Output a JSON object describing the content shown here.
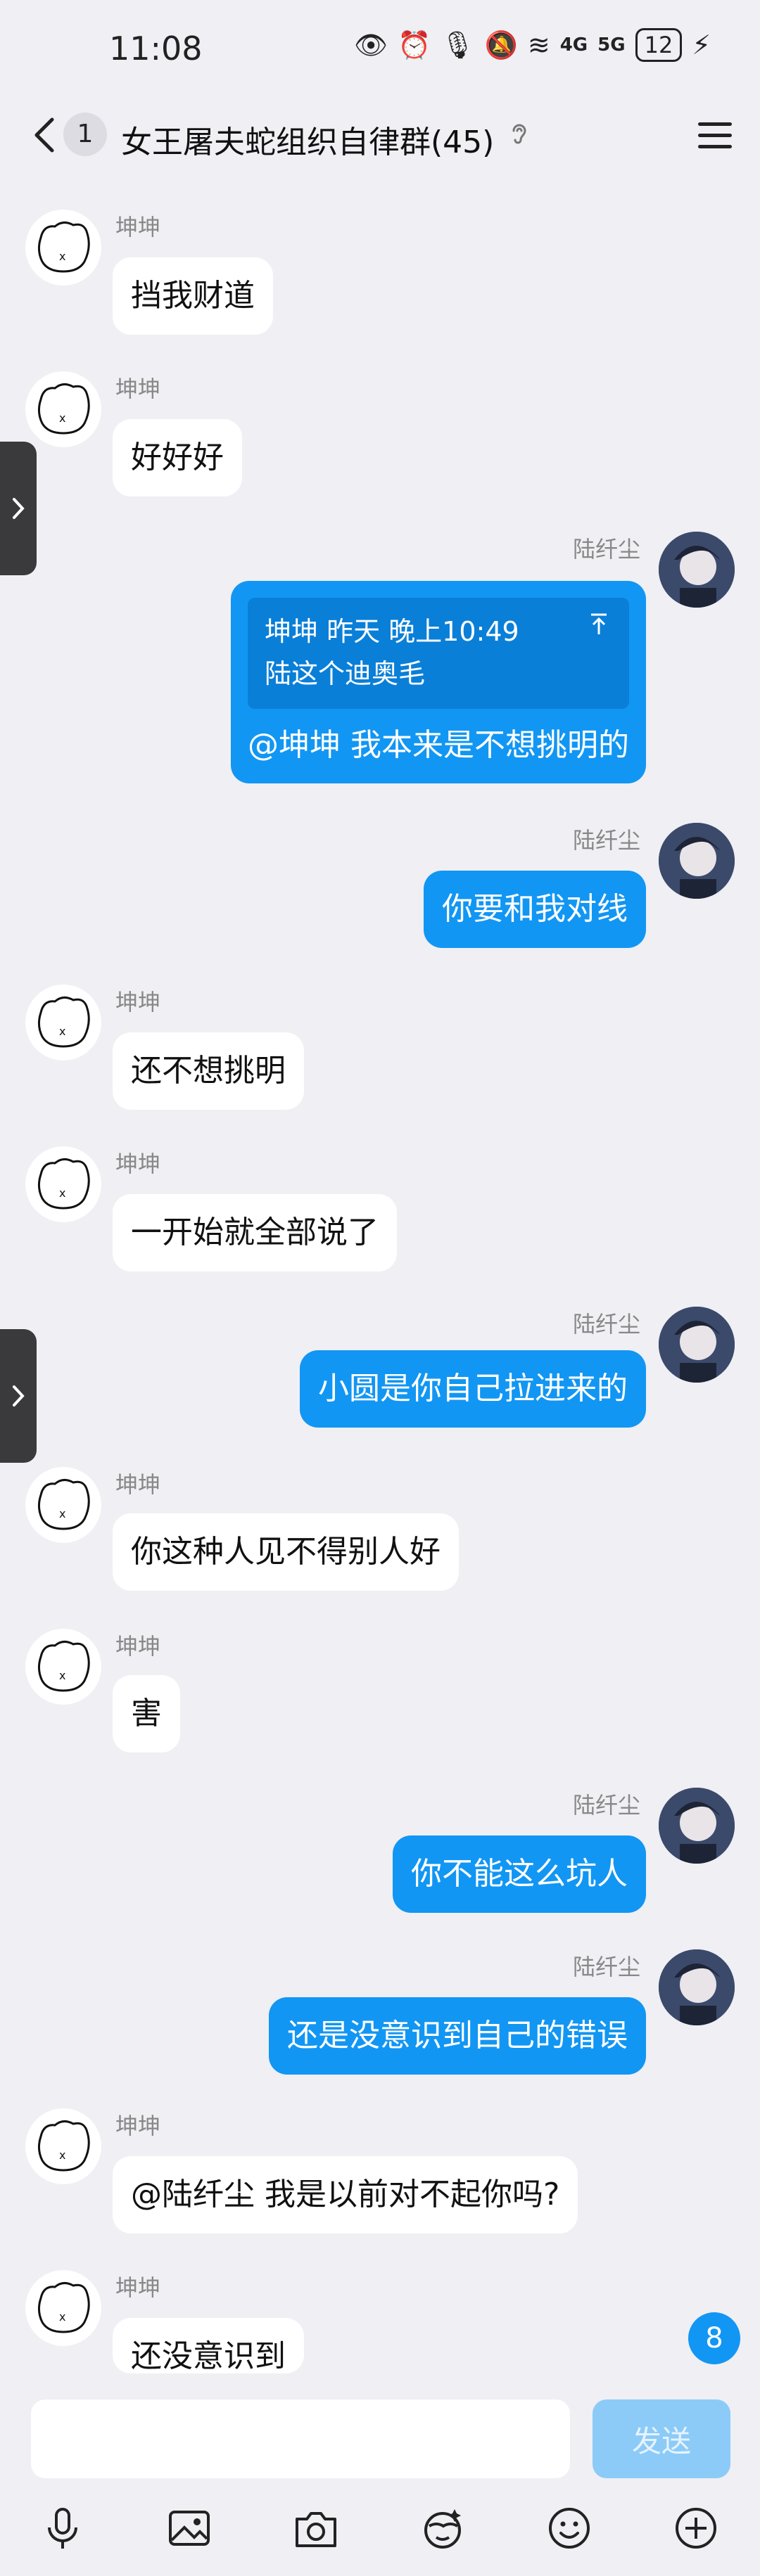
{
  "status": {
    "time": "11:08",
    "network_4g": "4G",
    "network_5g": "5G",
    "battery": "12"
  },
  "header": {
    "unread_count": "1",
    "title": "女王屠夫蛇组织自律群(45)"
  },
  "messages": [
    {
      "sender": "坤坤",
      "text": "挡我财道"
    },
    {
      "sender": "坤坤",
      "text": "好好好"
    },
    {
      "sender": "陆纤尘",
      "quote_meta": "坤坤 昨天 晚上10:49",
      "quote_text": "陆这个迪奥毛",
      "text": "@坤坤 我本来是不想挑明的"
    },
    {
      "sender": "陆纤尘",
      "text": "你要和我对线"
    },
    {
      "sender": "坤坤",
      "text": "还不想挑明"
    },
    {
      "sender": "坤坤",
      "text": "一开始就全部说了"
    },
    {
      "sender": "陆纤尘",
      "text": "小圆是你自己拉进来的"
    },
    {
      "sender": "坤坤",
      "text": "你这种人见不得别人好"
    },
    {
      "sender": "坤坤",
      "text": "害"
    },
    {
      "sender": "陆纤尘",
      "text": "你不能这么坑人"
    },
    {
      "sender": "陆纤尘",
      "text": "还是没意识到自己的错误"
    },
    {
      "sender": "坤坤",
      "text": "@陆纤尘 我是以前对不起你吗?"
    },
    {
      "sender": "坤坤",
      "text": "还没意识到"
    }
  ],
  "new_message_count": "8",
  "composer": {
    "placeholder": "",
    "send_label": "发送"
  },
  "toolbar_icons": [
    "microphone-icon",
    "image-icon",
    "camera-icon",
    "sticker-icon",
    "emoji-icon",
    "plus-icon"
  ],
  "colors": {
    "accent": "#1296f3",
    "background": "#efeff4",
    "bubble_left": "#ffffff"
  }
}
